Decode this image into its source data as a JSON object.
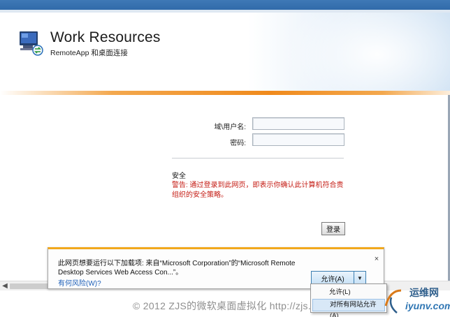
{
  "header": {
    "title": "Work Resources",
    "subtitle": "RemoteApp 和桌面连接"
  },
  "login_form": {
    "username_label": "域\\用户名:",
    "password_label": "密码:",
    "username_value": "",
    "password_value": "",
    "security_heading": "安全",
    "warning_text": "警告: 通过登录到此网页，即表示你确认此计算机符合贵组织的安全策略。",
    "login_button": "登录"
  },
  "notification_bar": {
    "message": "此网页想要运行以下加载项: 来自“Microsoft Corporation”的“Microsoft Remote Desktop Services Web Access Con...”。",
    "risk_link": "有何风险(W)?",
    "allow_button": "允许(A)",
    "close_symbol": "×",
    "dropdown_symbol": "▼",
    "menu": {
      "items": [
        "允许(L)",
        "对所有网站允许(A)"
      ],
      "highlighted_index": 1
    }
  },
  "scrollbar": {
    "left_arrow": "◀"
  },
  "footer": {
    "copyright": "© 2012 ZJS的微软桌面虚拟化 http://zjs.blog.51cto.com"
  },
  "watermark": {
    "line1": "运维网",
    "line2": "iyunv.com"
  },
  "colors": {
    "accent_orange": "#f08a1c",
    "top_strip_blue": "#2d67a6",
    "warning_red": "#c41a12",
    "link_blue": "#1d5fb8",
    "notification_border": "#f2a81d"
  }
}
